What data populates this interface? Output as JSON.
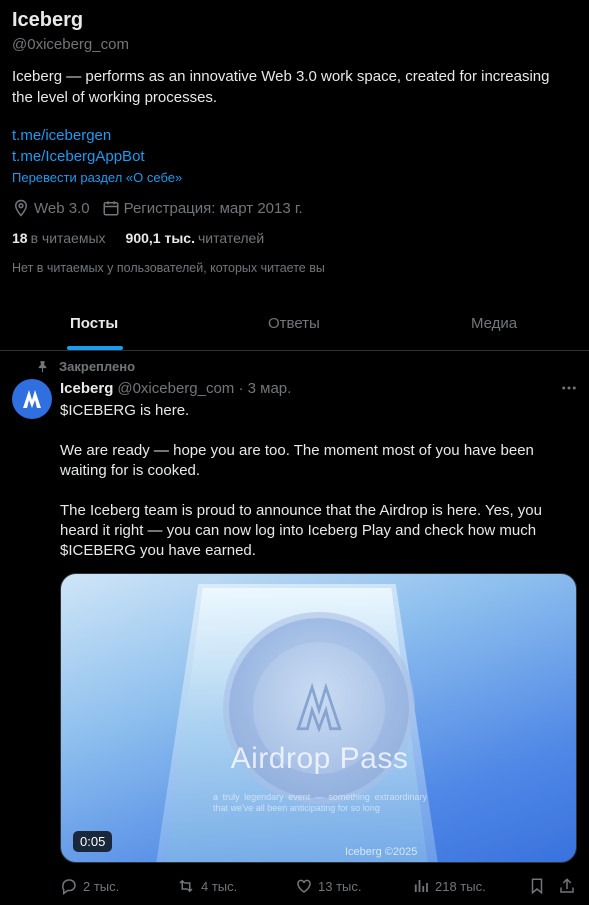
{
  "profile": {
    "name": "Iceberg",
    "handle": "@0xiceberg_com",
    "bio": "Iceberg — performs as an innovative Web 3.0 work space, created for increasing the level of working processes.",
    "links": [
      "t.me/icebergen",
      "t.me/IcebergAppBot"
    ],
    "translate": "Перевести раздел «О себе»",
    "location": "Web 3.0",
    "joined": "Регистрация: март 2013 г.",
    "following_count": "18",
    "following_label": "в читаемых",
    "followers_count": "900,1 тыс.",
    "followers_label": "читателей",
    "mutual_note": "Нет в читаемых у пользователей, которых читаете вы"
  },
  "tabs": [
    "Посты",
    "Ответы",
    "Медиа"
  ],
  "post": {
    "pinned_label": "Закреплено",
    "author": "Iceberg",
    "handle_date": "@0xiceberg_com · 3 мар.",
    "paragraphs": [
      "$ICEBERG is here.",
      "We are ready — hope you are too. The moment most of you have been waiting for is cooked.",
      "The Iceberg team is proud to announce that the Airdrop is here. Yes, you heard it right — you can now log into Iceberg Play and check how much $ICEBERG you have earned."
    ],
    "media": {
      "title": "Airdrop Pass",
      "subtitle": "a truly legendary event — something extraordinary that we've all been anticipating for so long",
      "footer": "Iceberg ©2025",
      "duration": "0:05"
    },
    "actions": {
      "replies": "2 тыс.",
      "reposts": "4 тыс.",
      "likes": "13 тыс.",
      "views": "218 тыс."
    }
  },
  "colors": {
    "accent": "#1d9bf0",
    "muted": "#71767b",
    "text": "#e7e9ea",
    "background": "#000000"
  },
  "icons": [
    "location-icon",
    "calendar-icon",
    "pin-icon",
    "more-icon",
    "play-icon",
    "reply-icon",
    "repost-icon",
    "like-icon",
    "views-icon",
    "bookmark-icon",
    "share-icon"
  ]
}
